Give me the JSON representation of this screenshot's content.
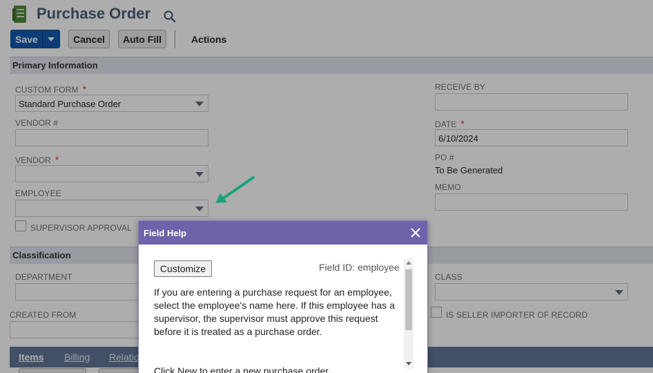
{
  "header": {
    "title": "Purchase Order",
    "icon": "document-icon",
    "search_icon": "search-icon"
  },
  "toolbar": {
    "save_label": "Save",
    "cancel_label": "Cancel",
    "autofill_label": "Auto Fill",
    "actions_label": "Actions"
  },
  "primary": {
    "section_title": "Primary Information",
    "custom_form": {
      "label": "CUSTOM FORM",
      "value": "Standard Purchase Order",
      "required": "*"
    },
    "vendor_num": {
      "label": "VENDOR #",
      "value": ""
    },
    "vendor": {
      "label": "VENDOR",
      "value": "",
      "required": "*"
    },
    "employee": {
      "label": "EMPLOYEE",
      "value": ""
    },
    "supervisor_approval": {
      "label": "SUPERVISOR APPROVAL",
      "checked": false
    },
    "receive_by": {
      "label": "RECEIVE BY",
      "value": ""
    },
    "date": {
      "label": "DATE",
      "value": "6/10/2024",
      "required": "*"
    },
    "po_num": {
      "label": "PO #",
      "value": "To Be Generated"
    },
    "memo": {
      "label": "MEMO",
      "value": ""
    }
  },
  "classification": {
    "section_title": "Classification",
    "department": {
      "label": "DEPARTMENT",
      "value": ""
    },
    "class": {
      "label": "CLASS",
      "value": ""
    },
    "created_from": {
      "label": "CREATED FROM",
      "value": ""
    },
    "seller_importer": {
      "label": "IS SELLER IMPORTER OF RECORD",
      "checked": false
    }
  },
  "subtabs": [
    {
      "label": "Items",
      "active": true
    },
    {
      "label": "Billing",
      "active": false
    },
    {
      "label": "Relatio",
      "active": false
    }
  ],
  "dialog": {
    "title": "Field Help",
    "customize_label": "Customize",
    "field_id": "Field ID: employee",
    "help_paragraph_1": "If you are entering a purchase request for an employee, select the employee's name here. If this employee has a supervisor, the supervisor must approve this request before it is treated as a purchase order.",
    "help_paragraph_2": "Click New to enter a new purchase order."
  },
  "colors": {
    "accent": "#125ab2",
    "dialog_header": "#6e62ab",
    "section_bg": "#e3e3ef",
    "subtab_bg": "#607799",
    "arrow": "#1aa07a",
    "required": "#e03a00"
  }
}
